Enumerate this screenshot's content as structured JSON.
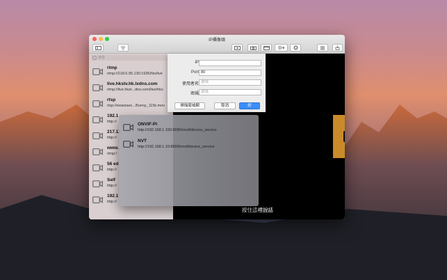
{
  "window": {
    "title": "IP攝像頭"
  },
  "toolbar": {
    "buttons": [
      {
        "icon": "sidebar-toggle-icon"
      },
      {
        "icon": "wifi-icon"
      },
      {
        "icon": "record-icon"
      },
      {
        "icon": "camera-icon"
      },
      {
        "icon": "window-icon"
      },
      {
        "icon": "gear-icon"
      },
      {
        "icon": "stop-icon"
      },
      {
        "icon": "list-icon"
      },
      {
        "icon": "share-icon"
      }
    ]
  },
  "sidebar": {
    "search_placeholder": "搜尋",
    "items": [
      {
        "name": "rtmp",
        "url": "rtmp://218.6.95.130:1935/hls/live"
      },
      {
        "name": "live.hkstv.hk.lxdns.com",
        "url": "rtmp://live.hkst...dns.com/live/hks"
      },
      {
        "name": "rtsp",
        "url": "rtsp://wowzaec...Bunny_115k.mov"
      },
      {
        "name": "192.1",
        "url": "http://"
      },
      {
        "name": "217.12",
        "url": "http://"
      },
      {
        "name": "www.",
        "url": "rtmp:/"
      },
      {
        "name": "56 ed",
        "url": "http://"
      },
      {
        "name": "Self",
        "url": "http://"
      },
      {
        "name": "192.1",
        "url": "http://"
      }
    ],
    "footer": {
      "add": "+",
      "remove": "−",
      "settings": "⚙",
      "play": "▶"
    }
  },
  "video": {
    "tap_message": "按住這裡說話"
  },
  "add_sheet": {
    "fields": [
      {
        "label": "IP",
        "value": "",
        "placeholder": ""
      },
      {
        "label": "Port",
        "value": "80",
        "placeholder": ""
      },
      {
        "label": "使用者名",
        "value": "",
        "placeholder": "選填"
      },
      {
        "label": "密碼",
        "value": "",
        "placeholder": "選填"
      }
    ],
    "scan_label": "掃描局域網",
    "cancel_label": "取消",
    "ok_label": "好"
  },
  "discovered": [
    {
      "name": "ONVIF-Pi",
      "url": "http://192.168.1.150:8080/onvif/device_service"
    },
    {
      "name": "NVT",
      "url": "http://192.168.1.10:8899/onvif/device_service"
    }
  ],
  "colors": {
    "accent": "#3b8ef7",
    "camera_icon": "#666666",
    "video_bg": "#000000"
  }
}
